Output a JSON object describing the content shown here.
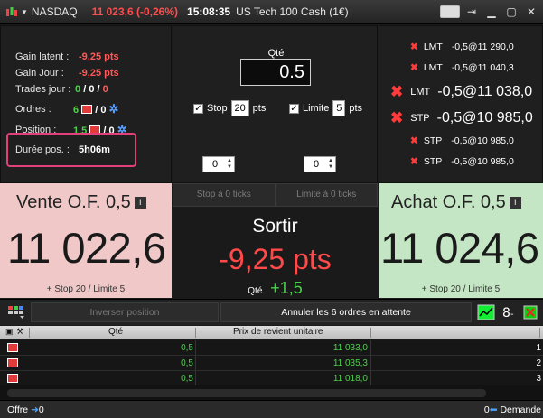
{
  "titlebar": {
    "instrument": "NASDAQ",
    "price": "11 023,6 (-0,26%)",
    "time": "15:08:35",
    "name": "US Tech 100 Cash (1€)",
    "icons": [
      "keyboard-icon",
      "pin-icon",
      "minimize-icon",
      "maximize-icon",
      "close-icon"
    ]
  },
  "stats": {
    "gain_latent_label": "Gain latent :",
    "gain_latent_value": "-9,25 pts",
    "gain_jour_label": "Gain Jour :",
    "gain_jour_value": "-9,25 pts",
    "trades_label": "Trades jour :",
    "trades_values": [
      "0",
      "0",
      "0"
    ],
    "ordres_label": "Ordres :",
    "ordres_value_a": "6",
    "ordres_value_b": "/ 0",
    "position_label": "Position :",
    "position_value_a": "1,5",
    "position_value_b": "/ 0",
    "duree_label": "Durée pos. :",
    "duree_value": "5h06m"
  },
  "order_ticket": {
    "qty_label": "Qté",
    "qty_value": "0.5",
    "stop_label": "Stop",
    "stop_value": "20",
    "stop_unit": "pts",
    "limit_label": "Limite",
    "limit_value": "5",
    "limit_unit": "pts",
    "spin_left": "0",
    "spin_right": "0"
  },
  "pending_orders": [
    {
      "type": "LMT",
      "text": "-0,5@11 290,0",
      "size": "small"
    },
    {
      "type": "LMT",
      "text": "-0,5@11 040,3",
      "size": "small"
    },
    {
      "type": "LMT",
      "text": "-0,5@11 038,0",
      "size": "big"
    },
    {
      "type": "STP",
      "text": "-0,5@10 985,0",
      "size": "big"
    },
    {
      "type": "STP",
      "text": "-0,5@10 985,0",
      "size": "small"
    },
    {
      "type": "STP",
      "text": "-0,5@10 985,0",
      "size": "small"
    }
  ],
  "sell": {
    "title": "Vente O.F. 0,5",
    "price": "11 022,6",
    "note": "+ Stop 20 / Limite 5"
  },
  "buy": {
    "title": "Achat O.F. 0,5",
    "price": "11 024,6",
    "note": "+ Stop 20 / Limite 5"
  },
  "center": {
    "stop_ticks": "Stop à 0 ticks",
    "limit_ticks": "Limite à 0 ticks",
    "exit_label": "Sortir",
    "pnl": "-9,25 pts",
    "qty_label": "Qté",
    "qty_value": "+1,5"
  },
  "toolbar": {
    "reverse_label": "Inverser position",
    "cancel_label": "Annuler les 6 ordres en attente"
  },
  "table": {
    "headers": [
      "Qté",
      "Prix de revient unitaire"
    ],
    "rows": [
      {
        "qty": "0,5",
        "price": "11 033,0",
        "id": "1"
      },
      {
        "qty": "0,5",
        "price": "11 035,3",
        "id": "2"
      },
      {
        "qty": "0,5",
        "price": "11 018,0",
        "id": "3"
      }
    ]
  },
  "footer": {
    "offer_label": "Offre",
    "offer_value": "0",
    "demand_value": "0",
    "demand_label": "Demande"
  },
  "colors": {
    "sell_bg": "#f0c8c8",
    "buy_bg": "#c4e6c4",
    "negative": "#ff4a4a",
    "positive": "#4cd04c"
  }
}
